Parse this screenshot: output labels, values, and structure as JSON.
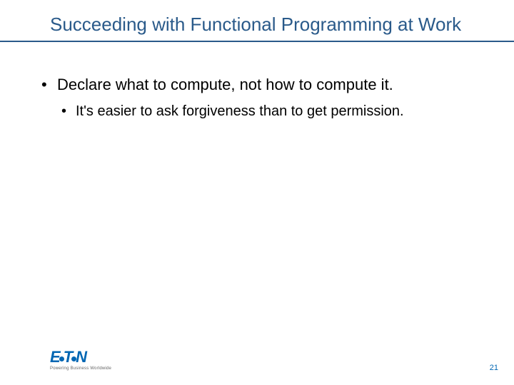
{
  "title": "Succeeding with Functional Programming at Work",
  "bullets": [
    {
      "text": "Declare what to compute, not how to compute it.",
      "sub": [
        "It's easier to ask forgiveness than to get permission."
      ]
    }
  ],
  "logo": {
    "brand_left": "E",
    "brand_mid": "T",
    "brand_right": "N",
    "tagline": "Powering Business Worldwide"
  },
  "page_number": "21"
}
